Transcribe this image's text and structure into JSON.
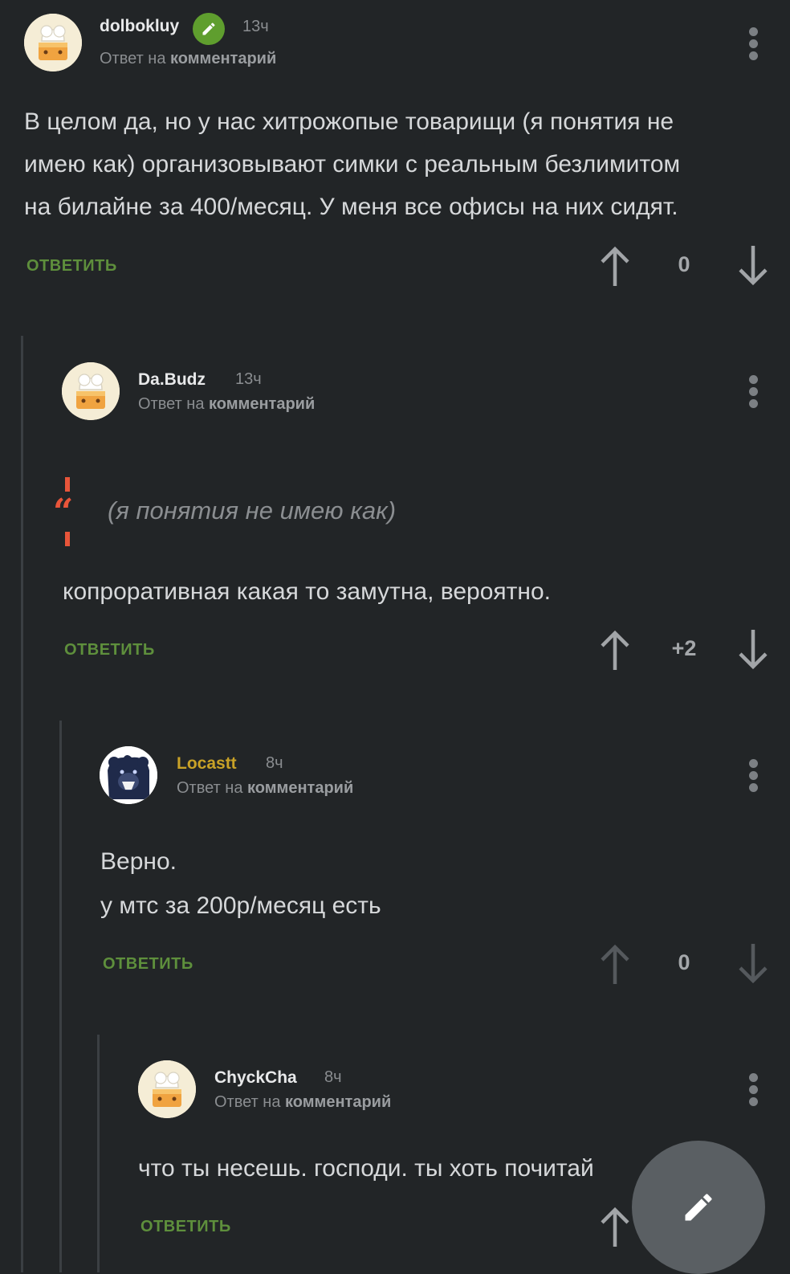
{
  "comments": [
    {
      "user": "dolbokluy",
      "time": "13ч",
      "reply_prefix": "Ответ на",
      "reply_link": "комментарий",
      "text_lines": [
        "В целом да, но у нас хитрожопые товарищи (я понятия не",
        "имею как) организовывают симки с реальным безлимитом",
        "на билайне за 400/месяц. У меня все офисы на них сидят."
      ],
      "reply_label": "ОТВЕТИТЬ",
      "score": "0"
    },
    {
      "user": "Da.Budz",
      "time": "13ч",
      "reply_prefix": "Ответ на",
      "reply_link": "комментарий",
      "quote": "(я понятия не имею как)",
      "text_lines": [
        "копроративная какая то замутна, вероятно."
      ],
      "reply_label": "ОТВЕТИТЬ",
      "score": "+2"
    },
    {
      "user": "Locastt",
      "time": "8ч",
      "reply_prefix": "Ответ на",
      "reply_link": "комментарий",
      "text_lines": [
        "Верно.",
        "у мтс за 200р/месяц есть"
      ],
      "reply_label": "ОТВЕТИТЬ",
      "score": "0"
    },
    {
      "user": "ChyckCha",
      "time": "8ч",
      "reply_prefix": "Ответ на",
      "reply_link": "комментарий",
      "text_lines": [
        "что ты несешь. господи. ты хоть почитай"
      ],
      "reply_label": "ОТВЕТИТЬ"
    }
  ],
  "colors": {
    "background": "#222527",
    "reply_green": "#5e8f3c",
    "username_gold": "#c9a227",
    "quote_red": "#e8553a",
    "badge_green": "#5f9e2e"
  },
  "icons": {
    "menu": "more-vert-icon",
    "up": "arrow-up-icon",
    "down": "arrow-down-icon",
    "edit": "pencil-icon"
  }
}
